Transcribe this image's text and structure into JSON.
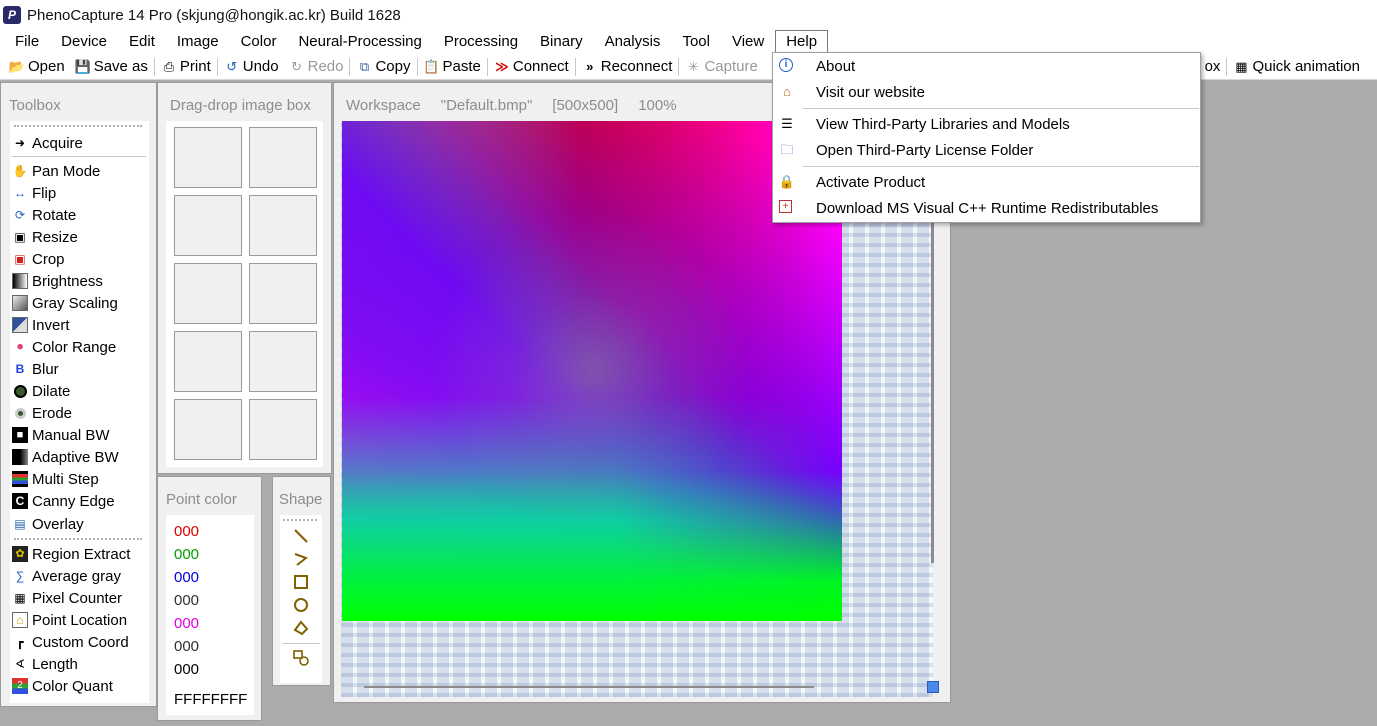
{
  "window": {
    "title": "PhenoCapture 14 Pro (skjung@hongik.ac.kr)  Build 1628",
    "app_icon": "P"
  },
  "menu": [
    "File",
    "Edit",
    "Image",
    "Color",
    "Neural-Processing",
    "Processing",
    "Binary",
    "Analysis",
    "Tool",
    "View",
    "Help"
  ],
  "menu_device": "Device",
  "toolbar": {
    "open": "Open",
    "save_as": "Save as",
    "print": "Print",
    "undo": "Undo",
    "redo": "Redo",
    "copy": "Copy",
    "paste": "Paste",
    "connect": "Connect",
    "reconnect": "Reconnect",
    "capture": "Capture",
    "partial_ox": "ox",
    "quick_animation": "Quick animation"
  },
  "toolbox": {
    "title": "Toolbox",
    "items": [
      "Acquire",
      "Pan Mode",
      "Flip",
      "Rotate",
      "Resize",
      "Crop",
      "Brightness",
      "Gray Scaling",
      "Invert",
      "Color Range",
      "Blur",
      "Dilate",
      "Erode",
      "Manual BW",
      "Adaptive BW",
      "Multi Step",
      "Canny Edge",
      "Overlay",
      "Region Extract",
      "Average gray",
      "Pixel Counter",
      "Point Location",
      "Custom Coord",
      "Length",
      "Color Quant"
    ]
  },
  "dragdrop": {
    "title": "Drag-drop image box"
  },
  "point_color": {
    "title": "Point color",
    "values": [
      "000",
      "000",
      "000",
      "000",
      "000",
      "000",
      "000"
    ],
    "colors": [
      "#e00000",
      "#00a000",
      "#0000e0",
      "#303030",
      "#e000e0",
      "#303030",
      "#000000"
    ],
    "hex": "FFFFFFFF"
  },
  "shape": {
    "title": "Shape",
    "icons": [
      "line-icon",
      "polyline-icon",
      "rectangle-icon",
      "circle-icon",
      "polygon-icon",
      "shape-link-icon"
    ]
  },
  "workspace": {
    "title": "Workspace",
    "file": "\"Default.bmp\"",
    "size": "[500x500]",
    "zoom": "100%"
  },
  "help_menu": {
    "items": [
      "About",
      "Visit our website",
      "View Third-Party Libraries and Models",
      "Open Third-Party License Folder",
      "Activate Product",
      "Download MS Visual C++ Runtime Redistributables"
    ]
  }
}
